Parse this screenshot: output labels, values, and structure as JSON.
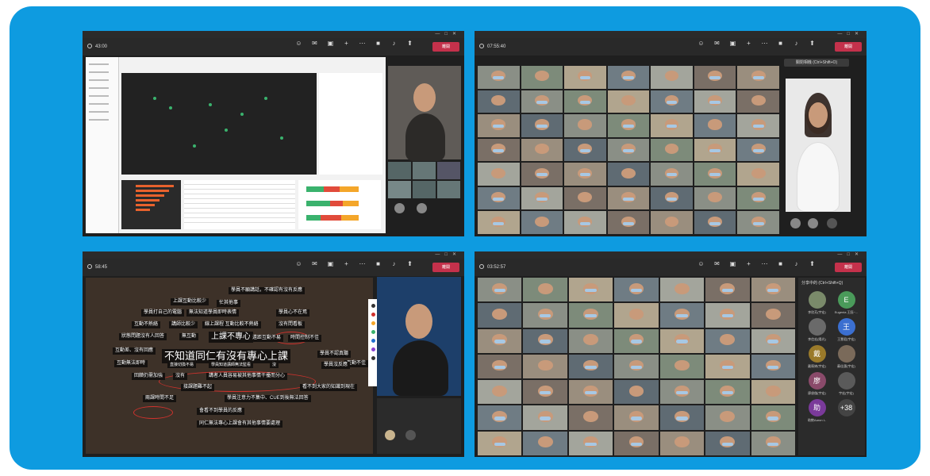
{
  "panels": {
    "top_left": {
      "meeting_time": "43:00"
    },
    "top_right": {
      "meeting_time": "07:55:40",
      "tooltip": "關閉相機 (Ctrl+Shift+O)"
    },
    "bottom_left": {
      "meeting_time": "58:45"
    },
    "bottom_right": {
      "meeting_time": "03:52:57"
    }
  },
  "toolbar": {
    "leave_label": "離開"
  },
  "word_cloud": {
    "words": [
      "學員不願講話，不確認有沒有反應",
      "上課互動比較少",
      "忙其他事",
      "學員打自己的電腦",
      "無法知道學員即時表情",
      "學員心不在焉",
      "互動不熱絡",
      "講師比較少",
      "線上課程 互動比較不熱絡",
      "沒有問看板",
      "狀態問題沒有人回答",
      "無互動",
      "上課不專心",
      "遠距互動不易",
      "時間控制不佳",
      "互動不佳",
      "互動差、沒有回應",
      "不知道同仁有沒有專心上課",
      "學員不認真聽",
      "互動無法即時",
      "直接切換不易",
      "學員知道講師無法監看",
      "沒",
      "學員沒反應",
      "回饋仍需加強",
      "沒有",
      "講者人員容易被其他事情干擾而分心",
      "接課題難不起",
      "看不到大家的知識到現在",
      "兩課時間不足",
      "學員注意力不集中、CUE到後無法回答",
      "會看不到學員的反應",
      "同仁無法專心上課會有其他事情要處理"
    ]
  },
  "roster": {
    "header": "分享中的 (Ctrl+Shift+Q)",
    "avatars": [
      {
        "initial": "",
        "label": "李欣芳(宇宏)"
      },
      {
        "initial": "E",
        "label": "Eugenia 王鈺~..."
      },
      {
        "initial": "",
        "label": "李信宏(陽光)"
      },
      {
        "initial": "王",
        "label": "王慧君(宇宏)"
      },
      {
        "initial": "戴",
        "label": "戴筱婷(宇宏)"
      },
      {
        "initial": "",
        "label": "蘇佳惠(宇宏)"
      },
      {
        "initial": "廖",
        "label": "廖俊傑(宇宏)"
      },
      {
        "initial": "",
        "label": "宇宏(宇宏)"
      },
      {
        "initial": "助",
        "label": "助教Aaron L."
      },
      {
        "initial": "+38",
        "label": ""
      }
    ]
  },
  "colors": {
    "frame": "#0e9be0",
    "leave": "#c4314b",
    "word_ring": "#d0322d"
  }
}
